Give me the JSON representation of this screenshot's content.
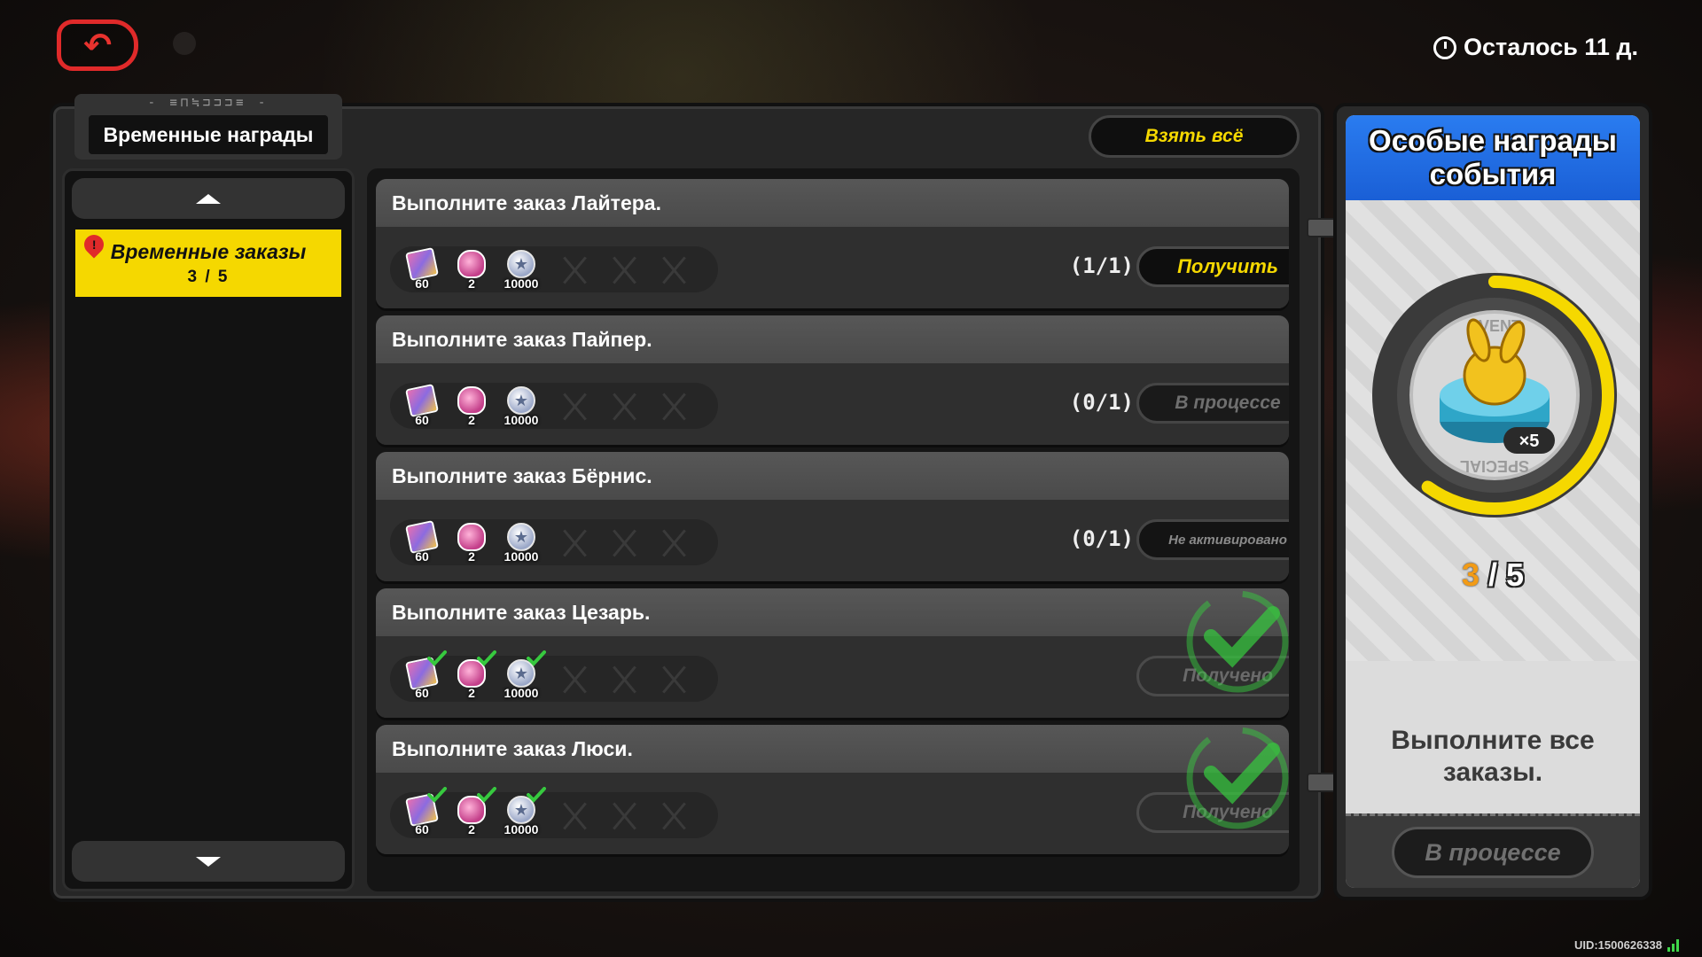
{
  "top": {
    "time_left": "Осталось 11 д."
  },
  "tab": {
    "decoration": "- ≡⊓≒⊐⊐⊐≡ -",
    "title": "Временные награды",
    "take_all": "Взять всё"
  },
  "sidebar": {
    "items": [
      {
        "label": "Временные заказы",
        "count": "3 / 5",
        "selected": true,
        "alert": "!"
      }
    ]
  },
  "orders": [
    {
      "title": "Выполните заказ Лайтера.",
      "rewards": [
        {
          "icon": "ticket-icon",
          "qty": "60",
          "claimed": false
        },
        {
          "icon": "gem-icon",
          "qty": "2",
          "claimed": false
        },
        {
          "icon": "coin-icon",
          "qty": "10000",
          "claimed": false
        }
      ],
      "progress": "(1/1)",
      "button": "Получить",
      "state": "claim"
    },
    {
      "title": "Выполните заказ Пайпер.",
      "rewards": [
        {
          "icon": "ticket-icon",
          "qty": "60",
          "claimed": false
        },
        {
          "icon": "gem-icon",
          "qty": "2",
          "claimed": false
        },
        {
          "icon": "coin-icon",
          "qty": "10000",
          "claimed": false
        }
      ],
      "progress": "(0/1)",
      "button": "В процессе",
      "state": "progress"
    },
    {
      "title": "Выполните заказ Бёрнис.",
      "rewards": [
        {
          "icon": "ticket-icon",
          "qty": "60",
          "claimed": false
        },
        {
          "icon": "gem-icon",
          "qty": "2",
          "claimed": false
        },
        {
          "icon": "coin-icon",
          "qty": "10000",
          "claimed": false
        }
      ],
      "progress": "(0/1)",
      "button": "Не активировано",
      "state": "inactive"
    },
    {
      "title": "Выполните заказ Цезарь.",
      "rewards": [
        {
          "icon": "ticket-icon",
          "qty": "60",
          "claimed": true
        },
        {
          "icon": "gem-icon",
          "qty": "2",
          "claimed": true
        },
        {
          "icon": "coin-icon",
          "qty": "10000",
          "claimed": true
        }
      ],
      "progress": "",
      "button": "Получено",
      "state": "received"
    },
    {
      "title": "Выполните заказ Люси.",
      "rewards": [
        {
          "icon": "ticket-icon",
          "qty": "60",
          "claimed": true
        },
        {
          "icon": "gem-icon",
          "qty": "2",
          "claimed": true
        },
        {
          "icon": "coin-icon",
          "qty": "10000",
          "claimed": true
        }
      ],
      "progress": "",
      "button": "Получено",
      "state": "received"
    }
  ],
  "event": {
    "title_line1": "Особые награды",
    "title_line2": "события",
    "badge_top": "EVENT",
    "badge_bottom": "SPECIAL",
    "item_qty": "×5",
    "progress_current": "3",
    "progress_sep": "/",
    "progress_total": "5",
    "progress_fraction": 0.6,
    "desc_line1": "Выполните все",
    "desc_line2": "заказы.",
    "button": "В процессе"
  },
  "footer": {
    "uid": "UID:1500626338"
  },
  "colors": {
    "accent_yellow": "#f5d800",
    "event_blue": "#1a5fd6",
    "back_red": "#e02a2a",
    "check_green": "#37c93f"
  }
}
